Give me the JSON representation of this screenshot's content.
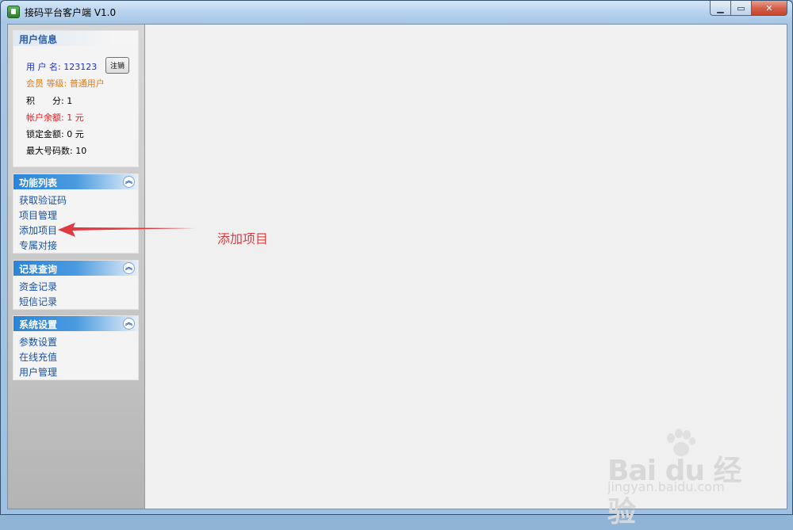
{
  "window": {
    "title": "接码平台客户端 V1.0"
  },
  "user_info": {
    "header": "用户信息",
    "username_label": "用 户 名:",
    "username_value": "123123",
    "logout_label": "注销",
    "level_label": "会员 等级:",
    "level_value": "普通用户",
    "points_label": "积　　分:",
    "points_value": "1",
    "balance_label": "帐户余额:",
    "balance_value": "1 元",
    "locked_label": "锁定金额:",
    "locked_value": "0 元",
    "max_label": "最大号码数:",
    "max_value": "10"
  },
  "functions": {
    "header": "功能列表",
    "items": [
      "获取验证码",
      "项目管理",
      "添加项目",
      "专属对接"
    ]
  },
  "records": {
    "header": "记录查询",
    "items": [
      "资金记录",
      "短信记录"
    ]
  },
  "settings": {
    "header": "系统设置",
    "items": [
      "参数设置",
      "在线充值",
      "用户管理"
    ]
  },
  "annotation": {
    "text": "添加项目",
    "color": "#e0393f"
  },
  "watermark": {
    "main": "Bai du 经验",
    "sub": "jingyan.baidu.com"
  }
}
